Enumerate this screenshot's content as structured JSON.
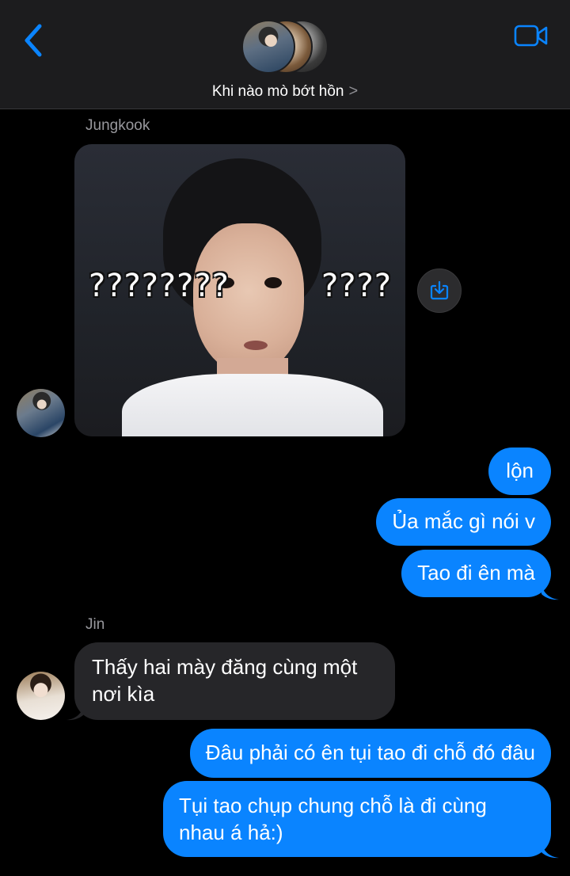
{
  "header": {
    "group_name": "Khi nào mò bớt hồn",
    "chevron": ">",
    "back_icon": "chevron-left-icon",
    "video_icon": "video-camera-icon",
    "accent_color": "#0a84ff"
  },
  "messages": [
    {
      "sender": "Jungkook",
      "type": "image",
      "image_text_left": "????????",
      "image_text_right": "????"
    },
    {
      "sender": "me",
      "type": "text",
      "text": "lộn"
    },
    {
      "sender": "me",
      "type": "text",
      "text": "Ủa mắc gì nói v"
    },
    {
      "sender": "me",
      "type": "text",
      "text": "Tao đi ên mà"
    },
    {
      "sender": "Jin",
      "type": "text",
      "text": "Thấy hai mày đăng cùng một nơi kìa"
    },
    {
      "sender": "me",
      "type": "text",
      "text": "Đâu phải có ên tụi tao đi chỗ đó đâu"
    },
    {
      "sender": "me",
      "type": "text",
      "text": "Tụi tao chụp chung chỗ là đi cùng nhau á hả:)"
    }
  ],
  "colors": {
    "outgoing_bubble": "#0a84ff",
    "incoming_bubble": "#262629",
    "background": "#000000",
    "header_background": "#1c1c1e"
  }
}
